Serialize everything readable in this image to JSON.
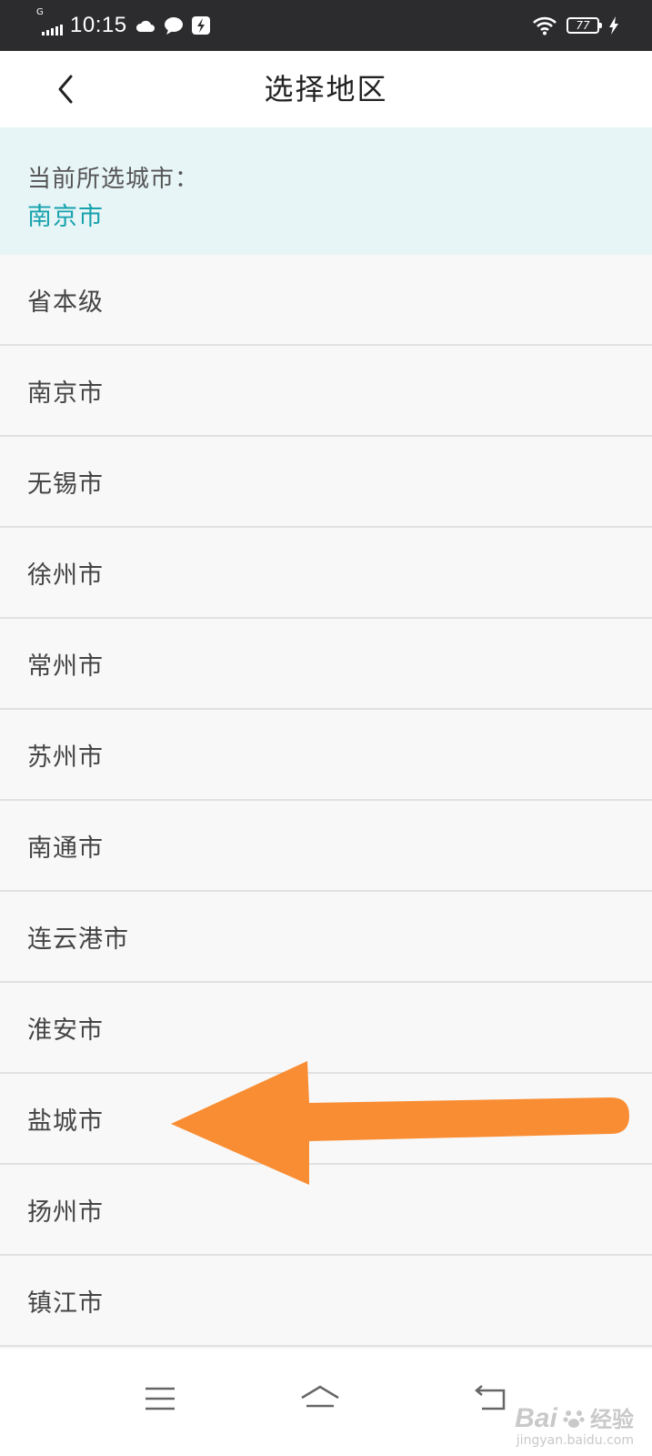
{
  "status_bar": {
    "network": "G",
    "time": "10:15",
    "battery": "77"
  },
  "header": {
    "title": "选择地区"
  },
  "current_city": {
    "label": "当前所选城市：",
    "value": "南京市"
  },
  "cities": [
    "省本级",
    "南京市",
    "无锡市",
    "徐州市",
    "常州市",
    "苏州市",
    "南通市",
    "连云港市",
    "淮安市",
    "盐城市",
    "扬州市",
    "镇江市"
  ],
  "annotation": {
    "arrow_color": "#f98d33",
    "points_to": "盐城市"
  },
  "watermark": {
    "brand": "Bai",
    "brand_suffix": "经验",
    "url": "jingyan.baidu.com"
  },
  "colors": {
    "status_bar_bg": "#2c2c2e",
    "accent": "#16a2ad",
    "panel_bg": "#e8f5f7"
  },
  "icons": {
    "back": "chevron-left-icon",
    "nav_menu": "menu-icon",
    "nav_home": "home-icon",
    "nav_back": "back-icon"
  }
}
